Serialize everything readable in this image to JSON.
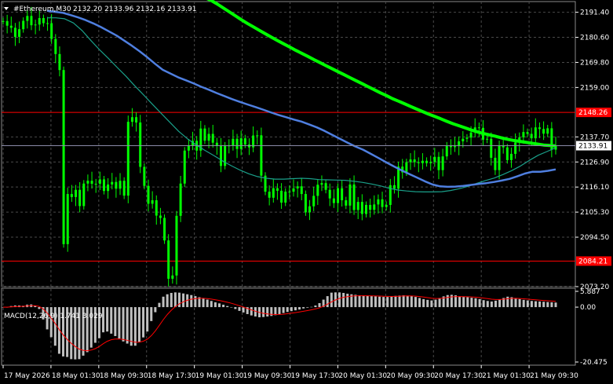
{
  "header": {
    "symbol": "#Ethereum,M30",
    "ohlc": "2132.20 2133.96 2132.16 2133.91"
  },
  "colors": {
    "background": "#000000",
    "grid": "#4a4a4a",
    "candle": "#00ff00",
    "ma_fast": "#00ff00",
    "ma_mid": "#4f7fe0",
    "ma_slow": "#1aa08a",
    "level_line": "#ff0000",
    "macd_hist": "#c0c0c0",
    "macd_signal": "#ff0000"
  },
  "price_axis": {
    "ticks": [
      "2191.40",
      "2180.60",
      "2169.80",
      "2159.00",
      "2137.70",
      "2126.90",
      "2116.10",
      "2105.30",
      "2094.50",
      "2073.20"
    ],
    "current_price": "2133.91",
    "level_upper": "2148.26",
    "level_lower": "2084.21"
  },
  "time_axis": {
    "labels": [
      "17 May 2026",
      "18 May 01:30",
      "18 May 09:30",
      "18 May 17:30",
      "19 May 01:30",
      "19 May 09:30",
      "19 May 17:30",
      "20 May 01:30",
      "20 May 09:30",
      "20 May 17:30",
      "21 May 01:30",
      "21 May 09:30"
    ]
  },
  "macd": {
    "label": "MACD(12,26,9) 1.741 3.029",
    "ticks": [
      "5.887",
      "0.00",
      "-20.475"
    ]
  },
  "chart_data": {
    "type": "candlestick",
    "price_range": [
      2073.2,
      2196.0
    ],
    "levels": [
      2148.26,
      2084.21
    ],
    "close_series": [
      2187.6,
      2185.6,
      2184.7,
      2180.8,
      2184.1,
      2187.7,
      2189.8,
      2185.8,
      2186.1,
      2188.9,
      2186.7,
      2186.7,
      2179.9,
      2173.4,
      2166.5,
      2091.5,
      2113.1,
      2111.8,
      2114.9,
      2107.9,
      2117.6,
      2118.8,
      2117.5,
      2117.5,
      2119.4,
      2114.4,
      2117.2,
      2118.3,
      2115.4,
      2118.8,
      2112.4,
      2144.2,
      2146.2,
      2143.9,
      2124.8,
      2116.6,
      2108.9,
      2110.4,
      2103.8,
      2102.8,
      2093.1,
      2076.6,
      2078.0,
      2103.7,
      2117.6,
      2131.8,
      2134.1,
      2136.0,
      2131.8,
      2141.3,
      2136.1,
      2139.0,
      2135.2,
      2133.9,
      2125.2,
      2134.0,
      2133.9,
      2136.9,
      2132.5,
      2137.1,
      2134.4,
      2133.2,
      2138.3,
      2138.4,
      2121.0,
      2114.1,
      2111.5,
      2115.6,
      2114.5,
      2109.4,
      2114.1,
      2114.1,
      2115.5,
      2116.4,
      2113.1,
      2105.2,
      2107.8,
      2112.3,
      2117.1,
      2117.8,
      2114.9,
      2111.2,
      2109.2,
      2115.6,
      2110.4,
      2108.1,
      2117.2,
      2106.2,
      2109.7,
      2104.5,
      2108.4,
      2106.3,
      2108.6,
      2110.8,
      2107.5,
      2108.4,
      2116.9,
      2115.4,
      2124.9,
      2122.4,
      2126.8,
      2128.0,
      2126.8,
      2126.4,
      2127.4,
      2126.4,
      2126.9,
      2129.1,
      2123.4,
      2129.3,
      2134.0,
      2133.3,
      2133.7,
      2135.8,
      2136.9,
      2137.4,
      2139.6,
      2141.8,
      2141.6,
      2136.5,
      2136.9,
      2128.7,
      2123.4,
      2134.0,
      2133.2,
      2127.7,
      2130.4,
      2135.3,
      2137.5,
      2139.8,
      2139.0,
      2137.1,
      2141.8,
      2141.1,
      2139.1,
      2141.4,
      2132.2,
      2133.9
    ],
    "ma_fast_series": [
      2205.9,
      2205.5,
      2204.0,
      2202.3,
      2200.6,
      2199.0,
      2197.7,
      2196.5,
      2195.0,
      2193.3,
      2191.6,
      2189.9,
      2188.2,
      2186.6,
      2185.1,
      2183.6,
      2182.1,
      2180.6,
      2179.2,
      2177.8,
      2176.4,
      2175.0,
      2173.7,
      2172.4,
      2171.0,
      2169.7,
      2168.4,
      2167.1,
      2165.8,
      2164.5,
      2163.2,
      2161.9,
      2160.6,
      2159.3,
      2158.0,
      2156.7,
      2155.5,
      2154.2,
      2153.1,
      2152.0,
      2150.8,
      2149.7,
      2148.6,
      2147.5,
      2146.5,
      2145.5,
      2144.4,
      2143.4,
      2142.5,
      2141.6,
      2140.7,
      2139.9,
      2139.2,
      2138.6,
      2138.0,
      2137.3,
      2136.7,
      2136.2,
      2135.8,
      2135.4,
      2135.0,
      2134.6,
      2134.2,
      2134.0,
      2133.8
    ],
    "ma_mid_series": [
      2192.0,
      2191.6,
      2191.2,
      2190.2,
      2189.2,
      2188.0,
      2186.6,
      2185.0,
      2183.2,
      2181.4,
      2179.2,
      2177.0,
      2174.6,
      2172.0,
      2169.2,
      2166.6,
      2165.0,
      2163.4,
      2162.1,
      2160.8,
      2159.3,
      2158.0,
      2156.6,
      2155.3,
      2154.0,
      2152.8,
      2151.7,
      2150.6,
      2149.5,
      2148.3,
      2147.2,
      2146.2,
      2145.2,
      2144.3,
      2143.1,
      2141.8,
      2140.3,
      2138.6,
      2136.9,
      2135.2,
      2133.6,
      2132.2,
      2130.4,
      2128.6,
      2126.8,
      2125.0,
      2123.3,
      2121.7,
      2120.2,
      2118.6,
      2117.2,
      2116.4,
      2116.2,
      2116.3,
      2116.6,
      2117.0,
      2117.4,
      2117.8,
      2118.3,
      2118.9,
      2119.6,
      2120.7,
      2121.9,
      2122.7,
      2122.7,
      2123.1,
      2123.7
    ],
    "ma_slow_series": [
      2189.0,
      2189.0,
      2188.6,
      2186.8,
      2183.5,
      2179.2,
      2175.2,
      2171.5,
      2167.6,
      2163.8,
      2159.7,
      2155.8,
      2151.8,
      2147.9,
      2144.0,
      2140.1,
      2136.9,
      2134.3,
      2131.9,
      2129.7,
      2127.4,
      2125.3,
      2123.4,
      2121.8,
      2120.6,
      2119.9,
      2119.5,
      2119.5,
      2119.7,
      2119.9,
      2119.7,
      2119.3,
      2119.2,
      2119.1,
      2119.0,
      2118.6,
      2118.1,
      2117.4,
      2116.6,
      2115.6,
      2114.8,
      2114.4,
      2114.1,
      2114.0,
      2114.0,
      2114.1,
      2114.6,
      2115.4,
      2116.4,
      2117.7,
      2118.9,
      2120.0,
      2121.5,
      2123.2,
      2125.2,
      2127.6,
      2129.8,
      2131.4,
      2133.0
    ],
    "macd_histogram": [
      0.0,
      0.0,
      0.4,
      0.6,
      0.6,
      0.5,
      0.9,
      1.0,
      0.6,
      -0.7,
      -4.6,
      -8.3,
      -11.2,
      -14.4,
      -17.4,
      -18.4,
      -18.6,
      -19.4,
      -19.5,
      -19.4,
      -18.1,
      -16.8,
      -15.1,
      -13.3,
      -11.6,
      -9.4,
      -9.1,
      -9.9,
      -10.8,
      -11.7,
      -12.8,
      -13.6,
      -14.4,
      -14.4,
      -13.0,
      -11.3,
      -9.1,
      -5.2,
      -1.9,
      1.6,
      3.9,
      4.8,
      5.3,
      5.5,
      5.4,
      5.1,
      4.8,
      4.5,
      4.1,
      3.7,
      3.2,
      2.8,
      2.3,
      1.8,
      1.4,
      0.9,
      0.4,
      -0.1,
      -0.7,
      -1.4,
      -2.0,
      -2.6,
      -3.1,
      -3.5,
      -3.8,
      -3.7,
      -3.5,
      -3.3,
      -3.0,
      -2.6,
      -2.2,
      -1.8,
      -1.5,
      -1.2,
      -0.9,
      -0.5,
      -0.2,
      0.1,
      0.6,
      1.5,
      2.8,
      4.1,
      5.4,
      5.5,
      5.5,
      5.3,
      5.0,
      4.8,
      4.6,
      4.4,
      4.3,
      4.2,
      4.1,
      4.0,
      3.9,
      3.8,
      3.8,
      3.9,
      4.2,
      4.3,
      4.4,
      4.3,
      4.1,
      3.8,
      3.4,
      3.0,
      2.7,
      2.5,
      2.8,
      3.4,
      4.0,
      4.5,
      4.6,
      4.4,
      4.0,
      3.8,
      3.7,
      3.5,
      3.3,
      3.0,
      2.6,
      2.3,
      2.1,
      2.4,
      2.9,
      3.4,
      3.9,
      3.7,
      3.3,
      3.0,
      2.7,
      2.5,
      2.3,
      2.2,
      2.1,
      2.0,
      1.9,
      1.8,
      1.7
    ],
    "macd_range": [
      -20.475,
      5.887
    ]
  }
}
